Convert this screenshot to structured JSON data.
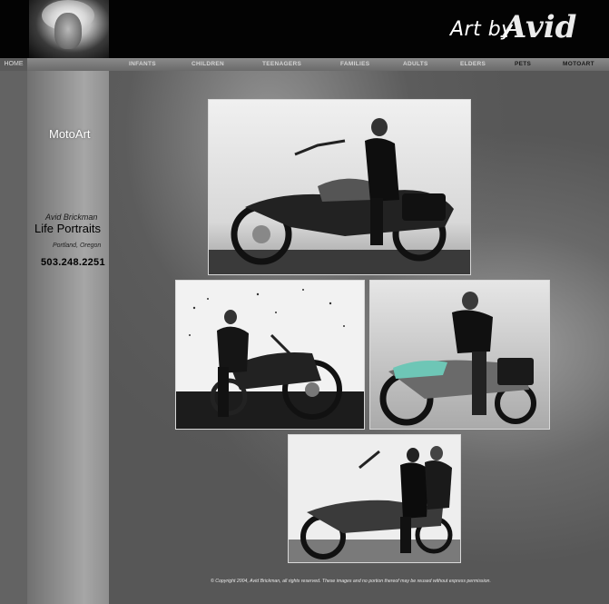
{
  "header": {
    "logo_text": "Art by",
    "logo_signature": "Avid"
  },
  "nav": {
    "home": "HOME",
    "items": [
      "INFANTS",
      "CHILDREN",
      "TEENAGERS",
      "FAMILIES",
      "ADULTS",
      "ELDERS",
      "PETS",
      "MOTOART"
    ],
    "active": "MOTOART"
  },
  "sidebar": {
    "section_title": "MotoArt",
    "name": "Avid Brickman",
    "tagline": "Life Portraits",
    "city": "Portland, Oregon",
    "phone": "503.248.2251"
  },
  "gallery": {
    "photos": [
      "motorcycle-photo-1",
      "motorcycle-photo-2",
      "motorcycle-photo-3",
      "motorcycle-photo-4"
    ]
  },
  "footer": {
    "copyright": "© Copyright 2004, Avid Brickman, all rights reserved. These images and no portion thereof may be reused without express permission."
  }
}
